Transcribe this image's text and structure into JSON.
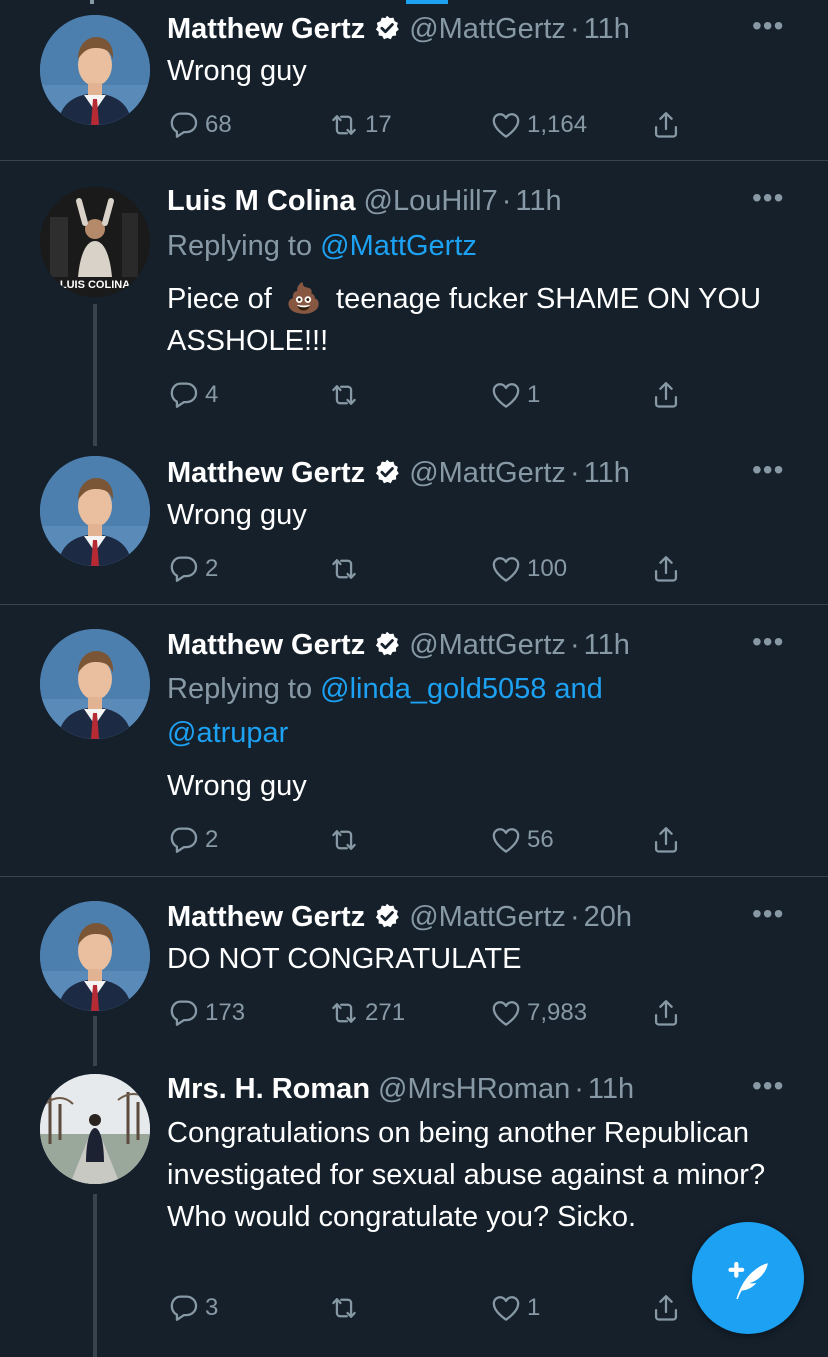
{
  "colors": {
    "background": "#15202b",
    "text": "#ffffff",
    "muted": "#8899a6",
    "accent": "#1da1f2",
    "divider": "#38444d"
  },
  "tweets": [
    {
      "name": "Matthew Gertz",
      "handle": "@MattGertz",
      "sep": "·",
      "time": "11h",
      "more": "•••",
      "replying_prefix": "",
      "replying_mentions": "",
      "text": "Wrong guy",
      "replies": "68",
      "retweets": "17",
      "likes": "1,164"
    },
    {
      "name": "Luis M Colina",
      "handle": "@LouHill7",
      "sep": "·",
      "time": "11h",
      "more": "•••",
      "replying_prefix": "Replying to ",
      "replying_mentions": "@MattGertz",
      "text_before": "Piece of",
      "text_emoji": "💩",
      "text_after": "teenage fucker SHAME ON YOU ASSHOLE!!!",
      "avatar_caption": "LUIS COLINA",
      "replies": "4",
      "retweets": "",
      "likes": "1"
    },
    {
      "name": "Matthew Gertz",
      "handle": "@MattGertz",
      "sep": "·",
      "time": "11h",
      "more": "•••",
      "text": "Wrong guy",
      "replies": "2",
      "retweets": "",
      "likes": "100"
    },
    {
      "name": "Matthew Gertz",
      "handle": "@MattGertz",
      "sep": "·",
      "time": "11h",
      "more": "•••",
      "replying_prefix": "Replying to ",
      "replying_mentions": "@linda_gold5058 and @atrupar",
      "text": "Wrong guy",
      "replies": "2",
      "retweets": "",
      "likes": "56"
    },
    {
      "name": "Matthew Gertz",
      "handle": "@MattGertz",
      "sep": "·",
      "time": "20h",
      "more": "•••",
      "text": "DO NOT CONGRATULATE",
      "replies": "173",
      "retweets": "271",
      "likes": "7,983"
    },
    {
      "name": "Mrs. H. Roman",
      "handle": "@MrsHRoman",
      "sep": "·",
      "time": "11h",
      "more": "•••",
      "text": "Congratulations on being another Republican investigated for sexual abuse against a minor? Who would congratulate you? Sicko.",
      "replies": "3",
      "retweets": "",
      "likes": "1"
    }
  ],
  "icons": {
    "reply": "reply-icon",
    "retweet": "retweet-icon",
    "like": "heart-icon",
    "share": "share-icon",
    "verified": "verified-badge-icon",
    "compose": "compose-tweet-icon"
  }
}
